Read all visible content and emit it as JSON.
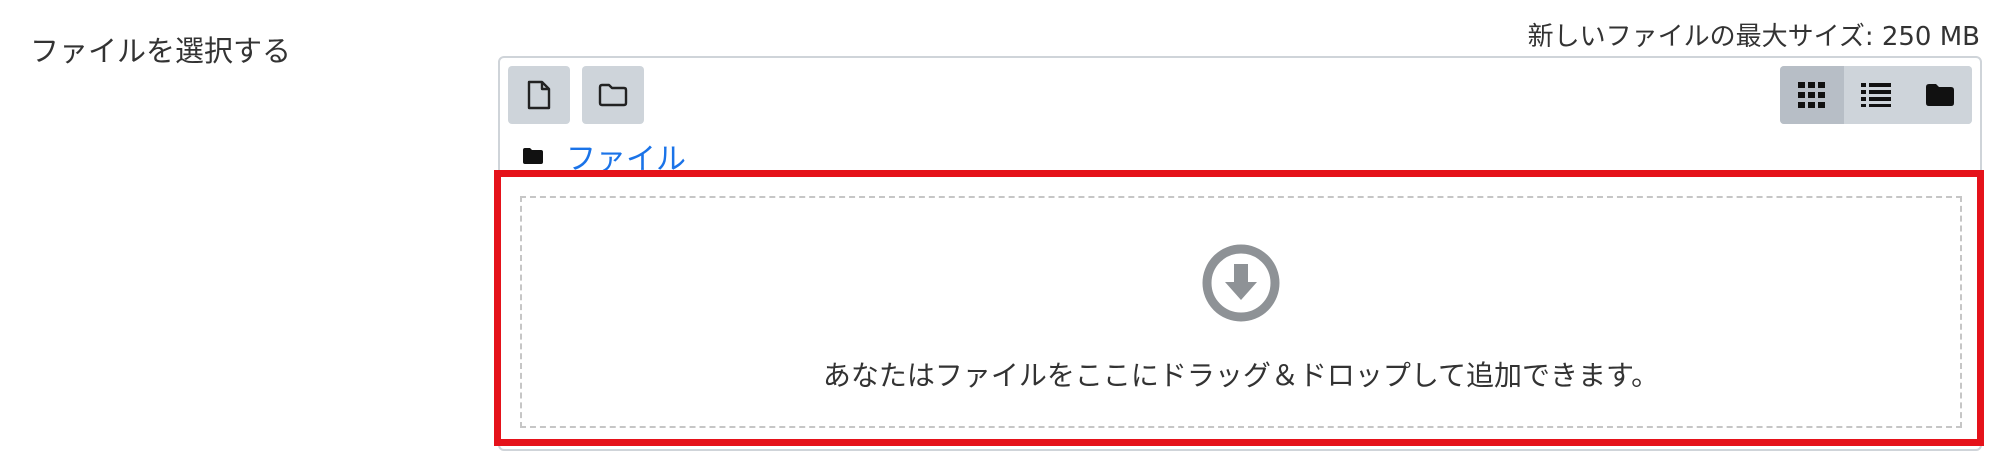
{
  "form": {
    "label": "ファイルを選択する",
    "max_size_text": "新しいファイルの最大サイズ: 250 MB"
  },
  "toolbar": {
    "add_file_icon": "file-icon",
    "create_folder_icon": "folder-outline-icon",
    "view_modes": [
      {
        "icon": "grid-icon",
        "active": true
      },
      {
        "icon": "list-icon",
        "active": false
      },
      {
        "icon": "folder-tree-icon",
        "active": false
      }
    ]
  },
  "breadcrumb": {
    "folder_icon": "folder-icon",
    "label": "ファイル"
  },
  "dropzone": {
    "icon": "arrow-circle-down-icon",
    "message": "あなたはファイルをここにドラッグ＆ドロップして追加できます。"
  },
  "colors": {
    "highlight": "#e5121a",
    "link": "#1a73e8",
    "button_bg": "#ced4da",
    "icon_gray": "#8e9296"
  }
}
